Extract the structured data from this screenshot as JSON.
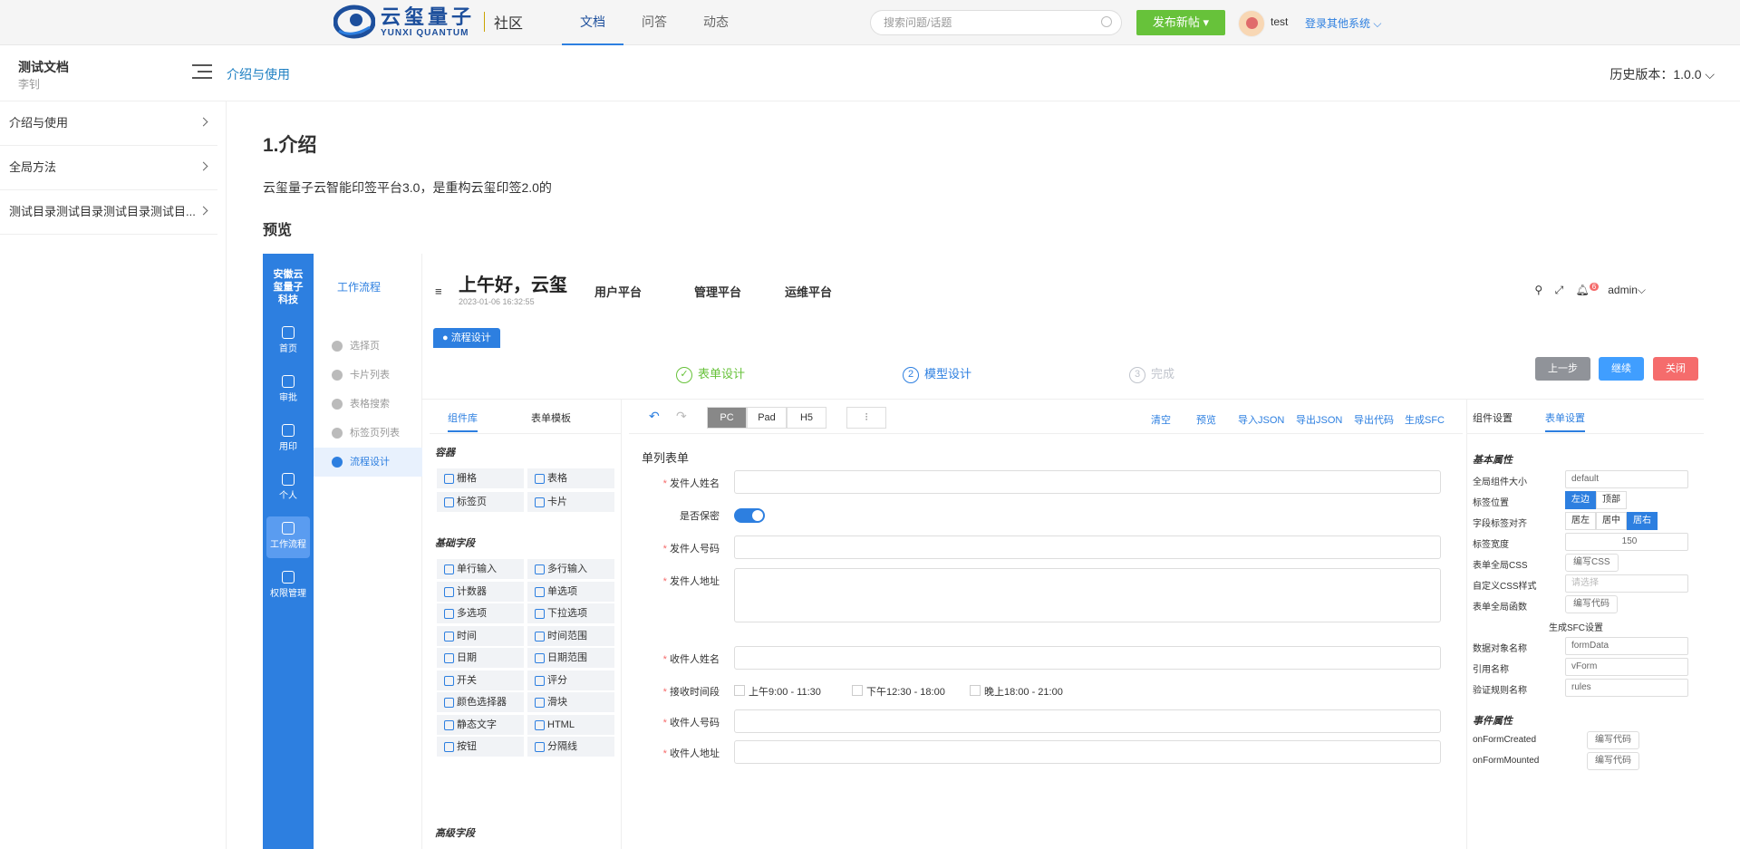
{
  "topbar": {
    "logo_cn": "云玺量子",
    "logo_en": "YUNXI QUANTUM",
    "community": "社区",
    "nav": [
      "文档",
      "问答",
      "动态"
    ],
    "search_placeholder": "搜索问题/话题",
    "publish": "发布新帖 ▾",
    "username": "test",
    "other_sys": "登录其他系统 ⌵"
  },
  "subbar": {
    "doc_title": "测试文档",
    "doc_author": "李钊",
    "breadcrumb": "介绍与使用",
    "version": "历史版本：1.0.0 ⌵"
  },
  "sidebar": {
    "items": [
      {
        "label": "介绍与使用"
      },
      {
        "label": "全局方法"
      },
      {
        "label": "测试目录测试目录测试目录测试目..."
      }
    ]
  },
  "content": {
    "h1": "1.介绍",
    "para": "云玺量子云智能印签平台3.0，是重构云玺印签2.0的",
    "h3": "预览"
  },
  "preview": {
    "brand": "安徽云玺量子科技",
    "rail": [
      "首页",
      "审批",
      "用印",
      "个人",
      "工作流程",
      "权限管理"
    ],
    "menu_header": "工作流程",
    "menu": [
      "选择页",
      "卡片列表",
      "表格搜索",
      "标签页列表",
      "流程设计"
    ],
    "greeting": "上午好，云玺",
    "time": "2023-01-06 16:32:55",
    "platforms": [
      "用户平台",
      "管理平台",
      "运维平台"
    ],
    "admin": "admin⌵",
    "badge": "6",
    "tag": "● 流程设计",
    "steps": [
      {
        "num": "✓",
        "label": "表单设计",
        "color": "#67c23a"
      },
      {
        "num": "2",
        "label": "模型设计",
        "color": "#2d7fe0"
      },
      {
        "num": "3",
        "label": "完成",
        "color": "#c0c4cc"
      }
    ],
    "buttons": [
      {
        "label": "上一步",
        "color": "#909399"
      },
      {
        "label": "继续",
        "color": "#409eff"
      },
      {
        "label": "关闭",
        "color": "#f56c6c"
      }
    ],
    "lib_tabs": [
      "组件库",
      "表单模板"
    ],
    "lib_sections": [
      "容器",
      "基础字段",
      "高级字段"
    ],
    "lib_container": [
      "栅格",
      "表格",
      "标签页",
      "卡片"
    ],
    "lib_basic": [
      "单行输入",
      "多行输入",
      "计数器",
      "单选项",
      "多选项",
      "下拉选项",
      "时间",
      "时间范围",
      "日期",
      "日期范围",
      "开关",
      "评分",
      "颜色选择器",
      "滑块",
      "静态文字",
      "HTML",
      "按钮",
      "分隔线"
    ],
    "devices": [
      "PC",
      "Pad",
      "H5"
    ],
    "canvas_actions": [
      "清空",
      "预览",
      "导入JSON",
      "导出JSON",
      "导出代码",
      "生成SFC"
    ],
    "form_title": "单列表单",
    "fields": [
      "发件人姓名",
      "是否保密",
      "发件人号码",
      "发件人地址",
      "收件人姓名",
      "接收时间段",
      "收件人号码",
      "收件人地址"
    ],
    "time_options": [
      "上午9:00 - 11:30",
      "下午12:30 - 18:00",
      "晚上18:00 - 21:00"
    ],
    "prop_tabs": [
      "组件设置",
      "表单设置"
    ],
    "prop_sections": [
      "基本属性",
      "事件属性"
    ],
    "props": {
      "size_label": "全局组件大小",
      "size_value": "default",
      "label_pos": "标签位置",
      "label_pos_opts": [
        "左边",
        "顶部"
      ],
      "label_align": "字段标签对齐",
      "label_align_opts": [
        "居左",
        "居中",
        "居右"
      ],
      "label_width": "标签宽度",
      "label_width_value": "150",
      "form_css": "表单全局CSS",
      "edit_css": "编写CSS",
      "custom_css": "自定义CSS样式",
      "custom_css_ph": "请选择",
      "global_fn": "表单全局函数",
      "edit_code": "编写代码",
      "sfc_title": "生成SFC设置",
      "data_obj": "数据对象名称",
      "data_obj_value": "formData",
      "ref_name": "引用名称",
      "ref_value": "vForm",
      "rules_name": "验证规则名称",
      "rules_value": "rules",
      "on_created": "onFormCreated",
      "on_mounted": "onFormMounted"
    }
  }
}
